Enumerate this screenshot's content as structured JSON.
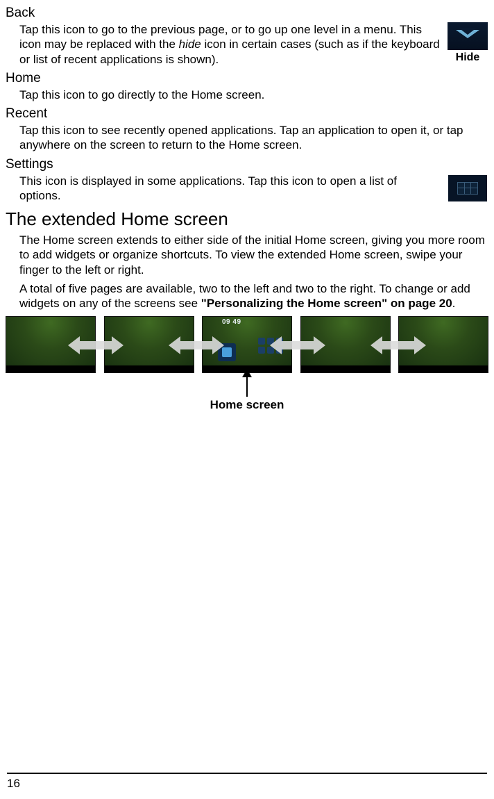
{
  "back": {
    "heading": "Back",
    "desc_a": "Tap this icon to go to the previous page, or to go up one level in a menu. This icon may be replaced with the ",
    "hide_word": "hide",
    "desc_b": " icon in certain cases (such as if the keyboard or list of recent applications is shown).",
    "caption": "Hide"
  },
  "home": {
    "heading": "Home",
    "desc": "Tap this icon to go directly to the Home screen."
  },
  "recent": {
    "heading": "Recent",
    "desc": "Tap this icon to see recently opened applications. Tap an application to open it, or tap anywhere on the screen to return to the Home screen."
  },
  "settings": {
    "heading": "Settings",
    "desc": "This icon is displayed in some applications. Tap this icon to open a list of options."
  },
  "ext": {
    "heading": "The extended Home screen",
    "p1": "The Home screen extends to either side of the initial Home screen, giving you more room to add widgets or organize shortcuts. To view the extended Home screen, swipe your finger to the left or right.",
    "p2a": "A total of five pages are available, two to the left and two to the right. To change or add widgets on any of the screens see ",
    "ref": "\"Personalizing the Home screen\" on page 20",
    "p2b": "."
  },
  "center_time": "09 49",
  "pointer_label": "Home screen",
  "page_number": "16"
}
